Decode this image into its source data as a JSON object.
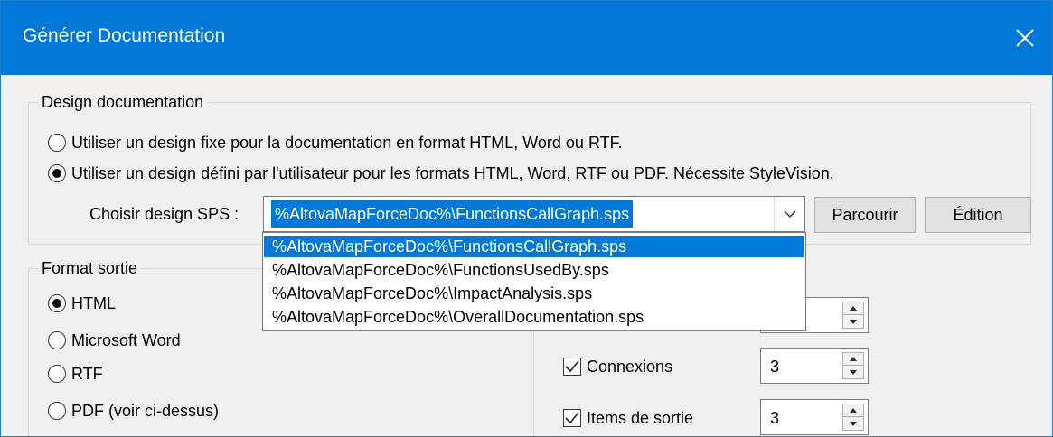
{
  "window": {
    "title": "Générer Documentation",
    "close_icon": "close-icon"
  },
  "design": {
    "legend": "Design documentation",
    "option_fixed": "Utiliser un design fixe pour la documentation en format HTML, Word ou RTF.",
    "option_user": "Utiliser un design défini par l'utilisateur pour les formats HTML, Word, RTF ou PDF. Nécessite StyleVision.",
    "selected_option": "user",
    "sps_label": "Choisir design SPS :",
    "sps_value": "%AltovaMapForceDoc%\\FunctionsCallGraph.sps",
    "browse_label": "Parcourir",
    "edit_label": "Édition",
    "dropdown_options": [
      "%AltovaMapForceDoc%\\FunctionsCallGraph.sps",
      "%AltovaMapForceDoc%\\FunctionsUsedBy.sps",
      "%AltovaMapForceDoc%\\ImpactAnalysis.sps",
      "%AltovaMapForceDoc%\\OverallDocumentation.sps"
    ]
  },
  "output": {
    "legend": "Format sortie",
    "formats": [
      "HTML",
      "Microsoft Word",
      "RTF",
      "PDF (voir ci-dessus)"
    ],
    "selected": "HTML"
  },
  "depth": {
    "rows": [
      {
        "label": "",
        "value": "",
        "checked": true
      },
      {
        "label": "Connexions",
        "value": "3",
        "checked": true
      },
      {
        "label": "Items de sortie",
        "value": "3",
        "checked": true
      }
    ]
  },
  "colors": {
    "accent": "#0078d7",
    "dialog_bg": "#f0f0f0"
  }
}
